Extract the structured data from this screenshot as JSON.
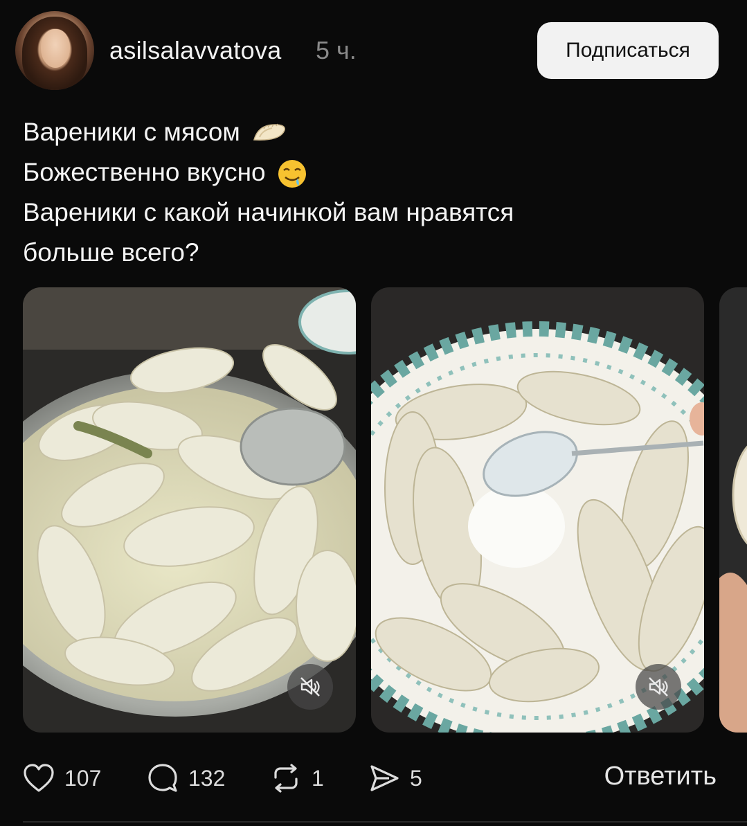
{
  "post": {
    "username": "asilsalavvatova",
    "time": "5 ч.",
    "follow_label": "Подписаться",
    "caption": {
      "line1": "Вареники с мясом",
      "line2": "Божественно вкусно",
      "line3": "Вареники с какой начинкой вам нравятся",
      "line4": "больше всего?"
    },
    "emoji": [
      "dumpling-emoji",
      "drooling-face-emoji"
    ],
    "media": [
      {
        "type": "video",
        "muted": true,
        "description_icon": "muted-speaker-icon"
      },
      {
        "type": "video",
        "muted": true,
        "description_icon": "muted-speaker-icon"
      },
      {
        "type": "image",
        "partially_visible": true
      }
    ]
  },
  "actions": {
    "likes": "107",
    "comments": "132",
    "reposts": "1",
    "shares": "5",
    "reply_label": "Ответить"
  },
  "colors": {
    "background": "#0a0a0a",
    "text": "#f3f3f3",
    "muted_text": "#8a8a8a",
    "button_bg": "#f2f2f2"
  }
}
